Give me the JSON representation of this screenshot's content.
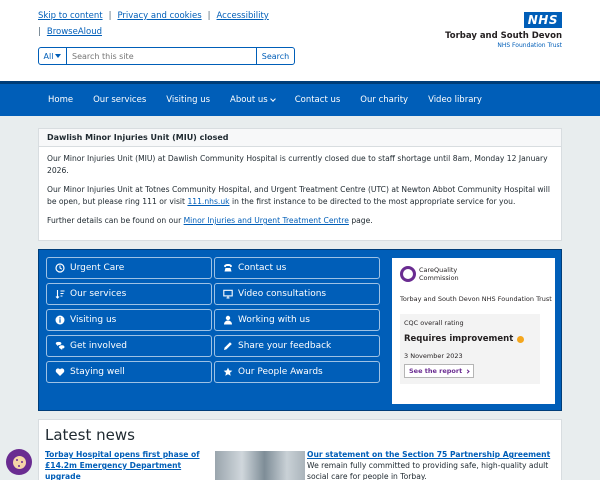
{
  "header": {
    "skip_links": [
      "Skip to content",
      "Privacy and cookies",
      "Accessibility"
    ],
    "browsealoud": "BrowseAloud",
    "search": {
      "scope": "All",
      "placeholder": "Search this site",
      "button": "Search"
    },
    "logo": {
      "nhs": "NHS",
      "org": "Torbay and South Devon",
      "trust": "NHS Foundation Trust"
    }
  },
  "nav": {
    "items": [
      "Home",
      "Our services",
      "Visiting us",
      "About us",
      "Contact us",
      "Our charity",
      "Video library"
    ]
  },
  "alert": {
    "title": "Dawlish Minor Injuries Unit (MIU) closed",
    "p1": "Our Minor Injuries Unit (MIU) at Dawlish Community Hospital is currently closed due to staff shortage until 8am, Monday 12 January 2026.",
    "p2_before": "Our Minor Injuries Unit at Totnes Community Hospital, and Urgent Treatment Centre (UTC) at Newton Abbot Community Hospital will be open, but please ring 111 or visit ",
    "p2_link": "111.nhs.uk",
    "p2_after": " in the first instance to be directed to the most appropriate service for you.",
    "p3_before": "Further details can be found on our ",
    "p3_link": "Minor Injuries and Urgent Treatment Centre",
    "p3_after": " page."
  },
  "quick_links": [
    {
      "label": "Urgent Care",
      "icon": "clock-icon"
    },
    {
      "label": "Contact us",
      "icon": "phone-icon"
    },
    {
      "label": "Our services",
      "icon": "sort-icon"
    },
    {
      "label": "Video consultations",
      "icon": "monitor-icon"
    },
    {
      "label": "Visiting us",
      "icon": "info-icon"
    },
    {
      "label": "Working with us",
      "icon": "user-icon"
    },
    {
      "label": "Get involved",
      "icon": "chat-icon"
    },
    {
      "label": "Share your feedback",
      "icon": "pencil-icon"
    },
    {
      "label": "Staying well",
      "icon": "heart-icon"
    },
    {
      "label": "Our People Awards",
      "icon": "star-icon"
    }
  ],
  "cqc": {
    "name_line1": "CareQuality",
    "name_line2": "Commission",
    "trust": "Torbay and South Devon NHS Foundation Trust",
    "rating_label": "CQC overall rating",
    "rating": "Requires improvement",
    "date": "3 November 2023",
    "cta": "See the report",
    "rating_color": "#f4a61d"
  },
  "news": {
    "heading": "Latest news",
    "item1": "Torbay Hospital opens first phase of £14.2m Emergency Department upgrade",
    "item2_title": "Our statement on the Section 75 Partnership Agreement",
    "item2_text": "We remain fully committed to providing safe, high-quality adult social care for people in Torbay."
  },
  "colors": {
    "primary": "#005eb8",
    "nav_border": "#003d78",
    "cqc_purple": "#6a2c91"
  }
}
